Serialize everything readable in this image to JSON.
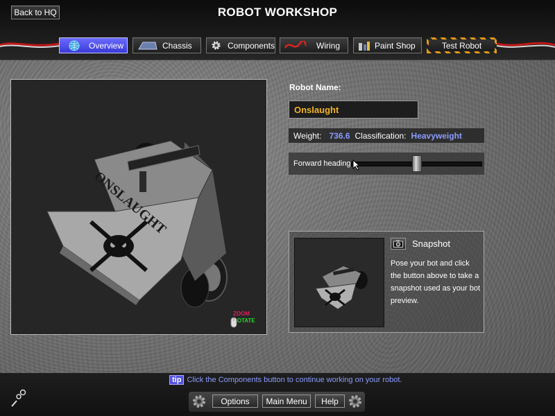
{
  "header": {
    "back_label": "Back to HQ",
    "title": "ROBOT WORKSHOP"
  },
  "tabs": [
    {
      "label": "Overview",
      "icon": "globe-icon",
      "active": true
    },
    {
      "label": "Chassis",
      "icon": "chassis-icon"
    },
    {
      "label": "Components",
      "icon": "gear-icon"
    },
    {
      "label": "Wiring",
      "icon": "wire-icon"
    },
    {
      "label": "Paint Shop",
      "icon": "paint-icon"
    },
    {
      "label": "Test Robot",
      "icon": null
    }
  ],
  "viewport": {
    "hint_zoom": "ZOOM",
    "hint_rotate": "ROTATE",
    "robot_text": "ONSLAUGHT"
  },
  "robot": {
    "name_label": "Robot Name:",
    "name_value": "Onslaught",
    "weight_label": "Weight:",
    "weight_value": "736.6",
    "class_label": "Classification:",
    "class_value": "Heavyweight",
    "heading_label": "Forward heading:",
    "heading_position": 0.5
  },
  "snapshot": {
    "title": "Snapshot",
    "description": "Pose your bot and click the button above to take a snapshot used as your bot preview."
  },
  "footer": {
    "tip_badge": "tip",
    "tip_text": "Click the Components button to continue working on your robot.",
    "options_label": "Options",
    "main_menu_label": "Main Menu",
    "help_label": "Help"
  },
  "colors": {
    "accent_blue": "#8c9cff",
    "name_gold": "#f0b429",
    "active_tab": "#4a4ae8",
    "hazard_orange": "#e39a1a"
  }
}
